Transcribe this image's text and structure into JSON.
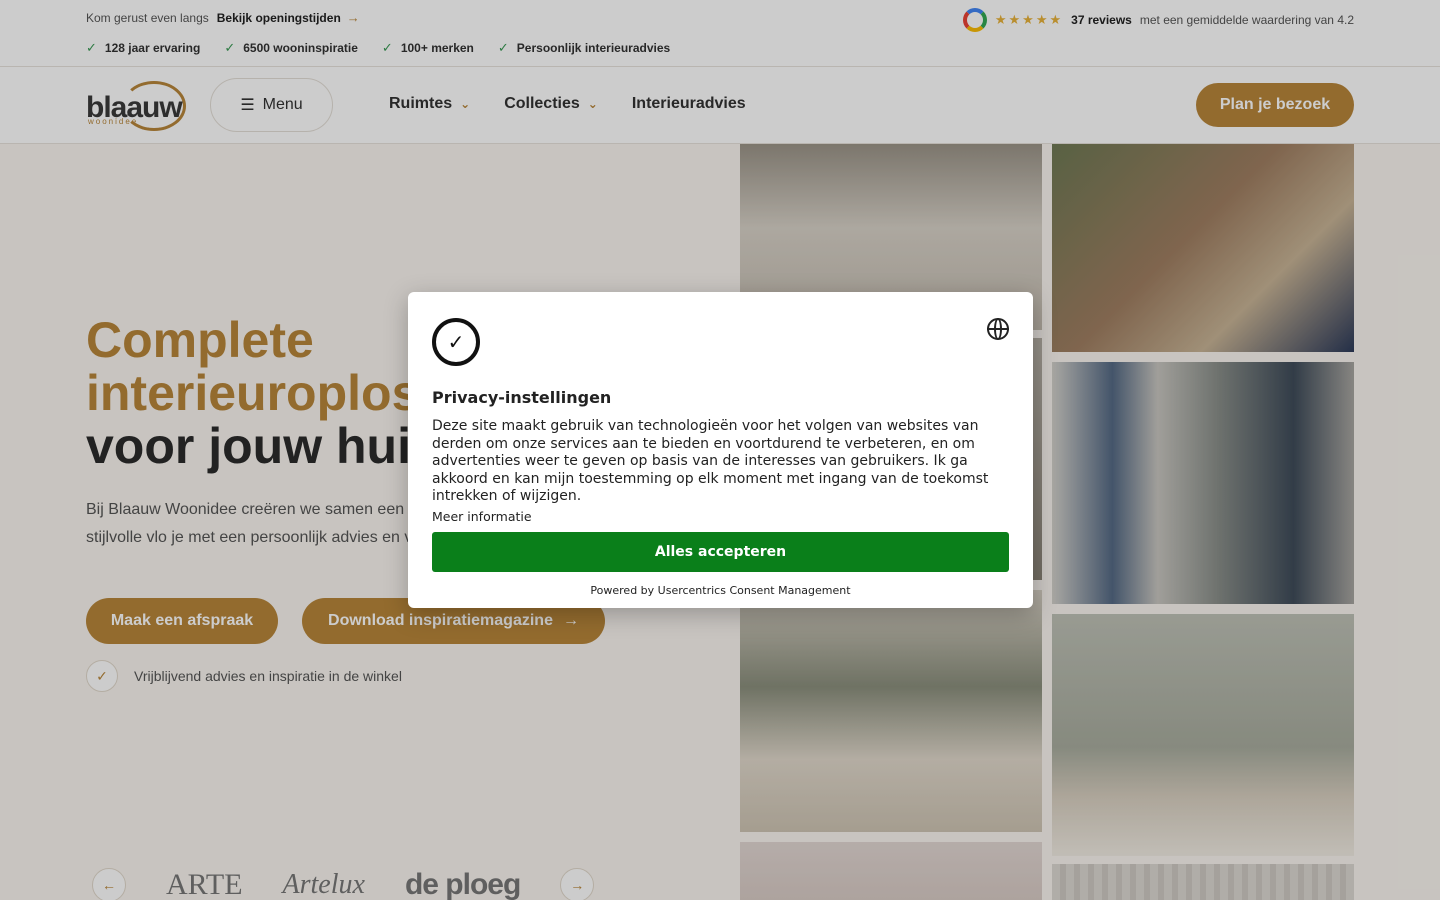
{
  "topbar": {
    "visit_text": "Kom gerust even langs",
    "hours_link": "Bekijk openingstijden",
    "usps": [
      "128 jaar ervaring",
      "6500 wooninspiratie",
      "100+ merken",
      "Persoonlijk interieuradvies"
    ],
    "stars": "★★★★★",
    "reviews_count": "37 reviews",
    "reviews_text": "met een gemiddelde waardering van 4.2"
  },
  "header": {
    "logo_text": "blaauw",
    "logo_sub": "woonidee",
    "menu_label": "Menu",
    "nav": [
      {
        "label": "Ruimtes"
      },
      {
        "label": "Collecties"
      },
      {
        "label": "Interieuradvies"
      }
    ],
    "cta": "Plan je bezoek"
  },
  "hero": {
    "title_line1": "Complete",
    "title_line2": "interieuroplos",
    "title_line3": "voor jouw huis",
    "body": "Bij Blaauw Woonidee creëren we samen een Van sfeervolle raamdecoratie tot stijlvolle vlo je met een persoonlijk advies en vakkundige",
    "btn_primary": "Maak een afspraak",
    "btn_secondary": "Download inspiratiemagazine",
    "advice": "Vrijblijvend advies en inspiratie in de winkel"
  },
  "brands": [
    "ARTE",
    "Artelux",
    "de ploeg"
  ],
  "modal": {
    "title": "Privacy-instellingen",
    "text": "Deze site maakt gebruik van technologieën voor het volgen van websites van derden om onze services aan te bieden en voortdurend te verbeteren, en om advertenties weer te geven op basis van de interesses van gebruikers. Ik ga akkoord en kan mijn toestemming op elk moment met ingang van de toekomst intrekken of wijzigen.",
    "more_info": "Meer informatie",
    "accept": "Alles accepteren",
    "powered": "Powered by Usercentrics Consent Management"
  },
  "colors": {
    "accent": "#b8863a",
    "accept_green": "#0a7f1a"
  }
}
